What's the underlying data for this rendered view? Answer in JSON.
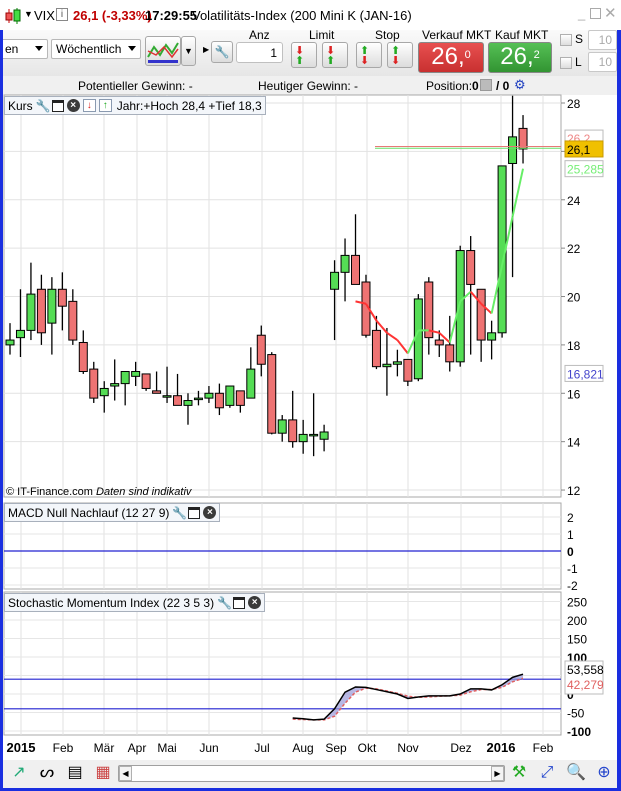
{
  "titlebar": {
    "symbol": "VIX",
    "info_icon": "i",
    "price_change": "26,1 (-3,33%)",
    "time": "17:29:55",
    "instrument": "Volatilitäts-Index (200 Mini K (JAN-16)",
    "price_color": "#c00000"
  },
  "toolbar": {
    "dropdown1_value": "en",
    "interval_value": "Wöchentlich",
    "anz_label": "Anz",
    "anz_value": "1",
    "limit_label": "Limit",
    "stop_label": "Stop",
    "sell_label": "Verkauf MKT",
    "sell_price_main": "26,",
    "sell_price_sup": "0",
    "buy_label": "Kauf MKT",
    "buy_price_main": "26,",
    "buy_price_sup": "2",
    "sell_color": "#d93b3b",
    "buy_color": "#3fa83f",
    "s_label": "S",
    "s_value": "10",
    "l_label": "L",
    "l_value": "10"
  },
  "info": {
    "potential_gain": "Potentieller Gewinn:  -",
    "today_gain": "Heutiger Gewinn:  -",
    "position_label": "Position:",
    "position_value": "0",
    "position_sep": "/ 0"
  },
  "main_panel": {
    "title": "Kurs",
    "range_text": "Jahr:+Hoch 28,4 +Tief 18,3",
    "watermark": "© IT-Finance.com",
    "watermark_note": "Daten sind indikativ",
    "price_ticks": [
      "28",
      "26",
      "24",
      "22",
      "20",
      "18",
      "16",
      "14",
      "12"
    ],
    "labels": {
      "ask": "26,2",
      "last": "26,1",
      "indicator": "25,285",
      "low_marker": "16,821"
    }
  },
  "macd_panel": {
    "title": "MACD Null Nachlauf (12 27 9)",
    "ticks": [
      "2",
      "1",
      "0",
      "-1",
      "-2"
    ]
  },
  "smi_panel": {
    "title": "Stochastic Momentum Index (22 3 5 3)",
    "ticks": [
      "250",
      "200",
      "150",
      "100",
      "50",
      "0",
      "-50",
      "-100"
    ],
    "labels": {
      "smi": "53,558",
      "signal": "42,279"
    }
  },
  "time_axis": [
    "2015",
    "Feb",
    "Mär",
    "Apr",
    "Mai",
    "Jun",
    "Jul",
    "Aug",
    "Sep",
    "Okt",
    "Nov",
    "Dez",
    "2016",
    "Feb"
  ],
  "chart_data": [
    {
      "type": "candlestick",
      "title": "Kurs",
      "interval": "Wöchentlich",
      "ylim": [
        12,
        28
      ],
      "grid": true,
      "ohlc_fields": [
        "open",
        "high",
        "low",
        "close"
      ],
      "ohlc": [
        [
          18.0,
          18.9,
          17.6,
          18.2
        ],
        [
          18.3,
          20.3,
          17.5,
          18.6
        ],
        [
          18.6,
          21.4,
          18.2,
          20.1
        ],
        [
          20.3,
          20.9,
          18.0,
          18.5
        ],
        [
          18.9,
          20.8,
          17.6,
          20.3
        ],
        [
          20.3,
          21.0,
          18.6,
          19.6
        ],
        [
          19.8,
          20.3,
          18.0,
          18.2
        ],
        [
          18.1,
          18.6,
          16.8,
          16.9
        ],
        [
          17.0,
          17.3,
          15.6,
          15.8
        ],
        [
          15.9,
          16.5,
          15.2,
          16.2
        ],
        [
          16.3,
          17.4,
          15.7,
          16.4
        ],
        [
          16.4,
          16.9,
          15.5,
          16.9
        ],
        [
          16.7,
          17.3,
          16.3,
          16.9
        ],
        [
          16.8,
          16.8,
          16.1,
          16.2
        ],
        [
          16.1,
          16.9,
          16.0,
          16.0
        ],
        [
          15.9,
          17.1,
          15.6,
          15.9
        ],
        [
          15.9,
          16.8,
          15.5,
          15.5
        ],
        [
          15.5,
          16.0,
          14.7,
          15.7
        ],
        [
          15.8,
          16.1,
          15.5,
          15.8
        ],
        [
          15.8,
          16.3,
          15.6,
          16.0
        ],
        [
          16.0,
          16.4,
          15.1,
          15.4
        ],
        [
          15.5,
          16.3,
          15.4,
          16.3
        ],
        [
          16.1,
          16.1,
          15.2,
          15.5
        ],
        [
          15.8,
          17.9,
          15.8,
          17.0
        ],
        [
          18.4,
          18.8,
          16.7,
          17.2
        ],
        [
          17.6,
          17.7,
          14.3,
          14.35
        ],
        [
          14.35,
          15.1,
          14.0,
          14.9
        ],
        [
          14.9,
          16.1,
          13.75,
          14.0
        ],
        [
          14.0,
          14.9,
          13.5,
          14.3
        ],
        [
          14.3,
          16.0,
          13.4,
          14.3
        ],
        [
          14.1,
          14.7,
          13.6,
          14.4
        ],
        [
          20.3,
          21.5,
          18.2,
          21.0
        ],
        [
          21.0,
          22.4,
          19.8,
          21.7
        ],
        [
          21.7,
          23.4,
          20.5,
          20.5
        ],
        [
          20.6,
          20.9,
          18.3,
          18.4
        ],
        [
          18.6,
          19.2,
          17.0,
          17.1
        ],
        [
          17.1,
          18.7,
          15.9,
          17.2
        ],
        [
          17.2,
          17.8,
          16.7,
          17.3
        ],
        [
          17.4,
          17.4,
          16.3,
          16.5
        ],
        [
          16.6,
          20.1,
          16.5,
          19.9
        ],
        [
          20.6,
          20.8,
          17.6,
          18.3
        ],
        [
          18.2,
          18.6,
          17.5,
          18.0
        ],
        [
          18.0,
          19.2,
          16.9,
          17.3
        ],
        [
          17.3,
          22.1,
          17.1,
          21.9
        ],
        [
          21.9,
          22.5,
          17.6,
          20.5
        ],
        [
          20.3,
          20.3,
          17.3,
          18.2
        ],
        [
          18.2,
          19.0,
          17.4,
          18.5
        ],
        [
          18.5,
          25.4,
          18.3,
          25.4
        ],
        [
          25.5,
          28.3,
          20.8,
          26.6
        ],
        [
          26.95,
          27.5,
          25.5,
          26.1
        ]
      ],
      "indicator_line": {
        "start_index": 33,
        "values": [
          19.8,
          19.7,
          19.0,
          18.5,
          18.2,
          17.65,
          18.6,
          18.6,
          18.5,
          18.1,
          19.8,
          20.2,
          19.7,
          19.3,
          21.3,
          23.3,
          25.285
        ],
        "up_color": "#66ee66",
        "down_color": "#ff3333"
      },
      "hlines": [
        {
          "value": 26.2,
          "color": "#e87878"
        },
        {
          "value": 26.13,
          "color": "#66e066"
        }
      ]
    },
    {
      "type": "line",
      "title": "MACD Null Nachlauf (12 27 9)",
      "ylim": [
        -2.2,
        2.5
      ],
      "zero_line_color": "#2020d0"
    },
    {
      "type": "line",
      "title": "Stochastic Momentum Index (22 3 5 3)",
      "ylim": [
        -110,
        260
      ],
      "start_index": 27,
      "series": [
        {
          "values": [
            -65,
            -67,
            -70,
            -68,
            -40,
            5,
            19,
            18,
            12,
            6,
            0,
            -12,
            -8,
            -5,
            -5,
            -5,
            0,
            14,
            14,
            11,
            25,
            45,
            53.558
          ],
          "color": "#000000"
        },
        {
          "values": [
            -68,
            -69,
            -70,
            -70,
            -60,
            -25,
            5,
            16,
            14,
            8,
            2,
            -6,
            -9,
            -8,
            -6,
            -5,
            -3,
            6,
            12,
            12,
            18,
            33,
            42.279
          ],
          "color": "#e06060"
        }
      ],
      "hlines": [
        40,
        -40
      ],
      "hline_color": "#2020d0",
      "fill_color": "#9a9ad8"
    }
  ]
}
